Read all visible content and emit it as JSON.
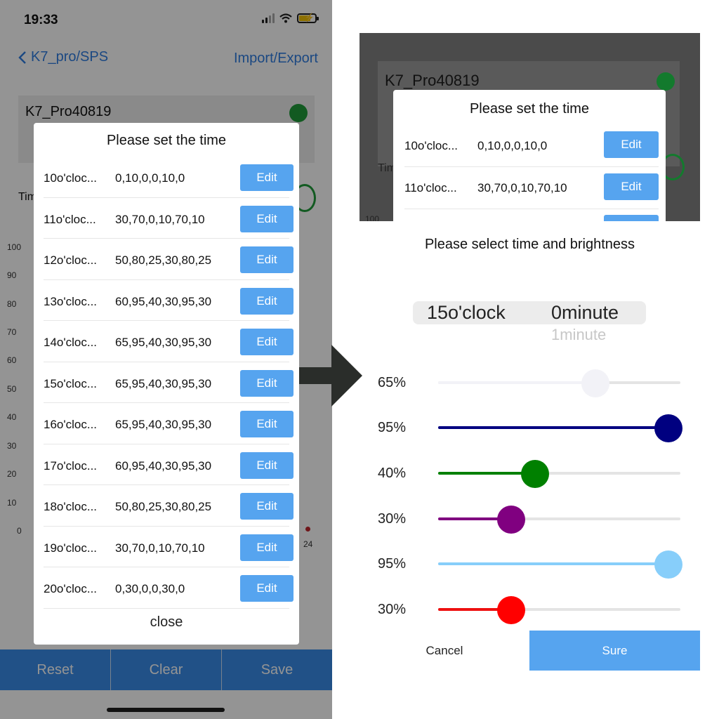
{
  "status": {
    "time": "19:33"
  },
  "nav": {
    "back_label": "K7_pro/SPS",
    "right_label": "Import/Export"
  },
  "device": {
    "name": "K7_Pro40819",
    "time_label": "Tim"
  },
  "chart": {
    "y_ticks": [
      "100",
      "90",
      "80",
      "70",
      "60",
      "50",
      "40",
      "30",
      "20",
      "10",
      "0"
    ],
    "x_last": "24"
  },
  "bottom_bar": {
    "reset": "Reset",
    "clear": "Clear",
    "save": "Save"
  },
  "modal": {
    "title": "Please set the time",
    "rows": [
      {
        "time": "10o'cloc...",
        "values": "0,10,0,0,10,0",
        "edit": "Edit"
      },
      {
        "time": "11o'cloc...",
        "values": "30,70,0,10,70,10",
        "edit": "Edit"
      },
      {
        "time": "12o'cloc...",
        "values": "50,80,25,30,80,25",
        "edit": "Edit"
      },
      {
        "time": "13o'cloc...",
        "values": "60,95,40,30,95,30",
        "edit": "Edit"
      },
      {
        "time": "14o'cloc...",
        "values": "65,95,40,30,95,30",
        "edit": "Edit"
      },
      {
        "time": "15o'cloc...",
        "values": "65,95,40,30,95,30",
        "edit": "Edit"
      },
      {
        "time": "16o'cloc...",
        "values": "65,95,40,30,95,30",
        "edit": "Edit"
      },
      {
        "time": "17o'cloc...",
        "values": "60,95,40,30,95,30",
        "edit": "Edit"
      },
      {
        "time": "18o'cloc...",
        "values": "50,80,25,30,80,25",
        "edit": "Edit"
      },
      {
        "time": "19o'cloc...",
        "values": "30,70,0,10,70,10",
        "edit": "Edit"
      },
      {
        "time": "20o'cloc...",
        "values": "0,30,0,0,30,0",
        "edit": "Edit"
      }
    ],
    "close": "close"
  },
  "right_panel": {
    "preview": {
      "device_name": "K7_Pro40819",
      "time_label": "Tim",
      "y_top": "100",
      "title": "Please set the time",
      "rows": [
        {
          "time": "10o'cloc...",
          "values": "0,10,0,0,10,0",
          "edit": "Edit"
        },
        {
          "time": "11o'cloc...",
          "values": "30,70,0,10,70,10",
          "edit": "Edit"
        }
      ]
    },
    "title": "Please select time and brightness",
    "picker": {
      "hour": "15o'clock",
      "minute": "0minute",
      "next_minute": "1minute"
    },
    "sliders": [
      {
        "label": "65%",
        "value": 0.65,
        "color": "#f2f2f7",
        "knob": "#f2f2f7"
      },
      {
        "label": "95%",
        "value": 0.95,
        "color": "#000080",
        "knob": "#000080"
      },
      {
        "label": "40%",
        "value": 0.4,
        "color": "#008000",
        "knob": "#008000"
      },
      {
        "label": "30%",
        "value": 0.3,
        "color": "#800080",
        "knob": "#800080"
      },
      {
        "label": "95%",
        "value": 0.95,
        "color": "#87cefa",
        "knob": "#87cefa"
      },
      {
        "label": "30%",
        "value": 0.3,
        "color": "#ee1111",
        "knob": "#ff0000"
      }
    ],
    "cancel": "Cancel",
    "sure": "Sure"
  },
  "colors": {
    "accent": "#56a4ef",
    "link": "#2f7de1",
    "bar": "#3a8ce8",
    "status_green": "#1f9c3a"
  }
}
